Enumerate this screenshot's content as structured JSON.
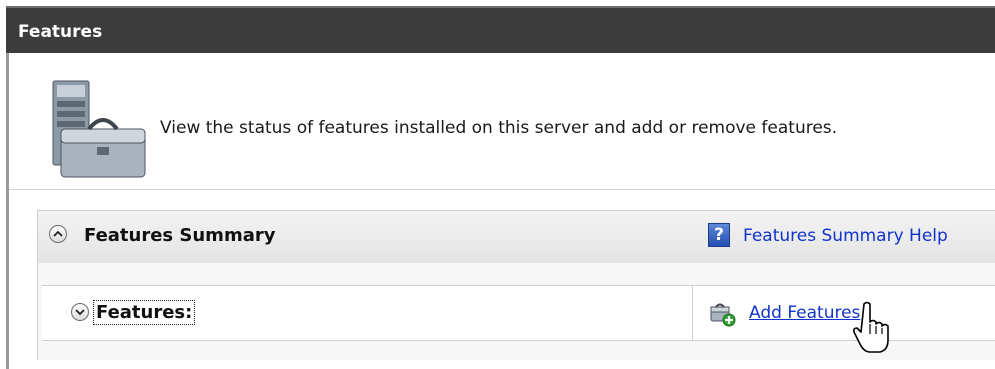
{
  "window": {
    "title": "Features"
  },
  "banner": {
    "description": "View the status of features installed on this server and add or remove features.",
    "icon": "server-toolbox-icon"
  },
  "summary_section": {
    "title": "Features Summary",
    "help_link": "Features Summary Help",
    "help_icon": "help-question-icon",
    "collapse_icon": "chevron-up-icon",
    "features_row": {
      "label": "Features:",
      "expand_icon": "chevron-down-icon",
      "action_link": "Add Features",
      "action_icon": "add-features-icon"
    }
  },
  "colors": {
    "title_bar": "#3c3c3c",
    "link": "#1033cc",
    "section_header": "#e8e8e8"
  }
}
